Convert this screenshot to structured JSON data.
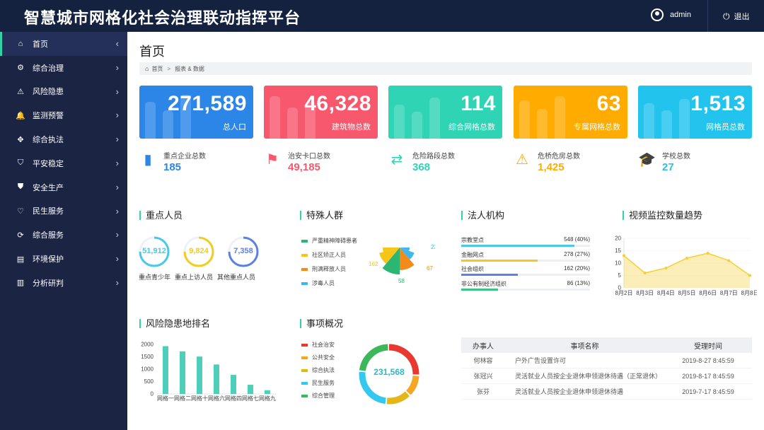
{
  "header": {
    "title": "智慧城市网格化社会治理联动指挥平台",
    "username": "admin",
    "logout_label": "退出"
  },
  "sidebar": {
    "items": [
      {
        "label": "首页",
        "icon": "home-icon",
        "glyph": "⌂"
      },
      {
        "label": "综合治理",
        "icon": "gear-icon",
        "glyph": "⚙"
      },
      {
        "label": "风险隐患",
        "icon": "warning-icon",
        "glyph": "⚠"
      },
      {
        "label": "监测预警",
        "icon": "bell-icon",
        "glyph": "🔔"
      },
      {
        "label": "综合执法",
        "icon": "move-icon",
        "glyph": "✥"
      },
      {
        "label": "平安稳定",
        "icon": "shield-check-icon",
        "glyph": "⛉"
      },
      {
        "label": "安全生产",
        "icon": "shield-icon",
        "glyph": "⛊"
      },
      {
        "label": "民生服务",
        "icon": "heart-icon",
        "glyph": "♡"
      },
      {
        "label": "综合服务",
        "icon": "sync-icon",
        "glyph": "⟳"
      },
      {
        "label": "环境保护",
        "icon": "building-icon",
        "glyph": "▤"
      },
      {
        "label": "分析研判",
        "icon": "chart-icon",
        "glyph": "▥"
      }
    ]
  },
  "page": {
    "title": "首页",
    "breadcrumb": [
      "首页",
      "报表 & 数据"
    ]
  },
  "stat_cards": [
    {
      "value": "271,589",
      "label": "总人口",
      "color": "#2b86e8"
    },
    {
      "value": "46,328",
      "label": "建筑物总数",
      "color": "#f7586d"
    },
    {
      "value": "114",
      "label": "综合网格总数",
      "color": "#2fd4b5"
    },
    {
      "value": "63",
      "label": "专属网格总数",
      "color": "#ffab00"
    },
    {
      "value": "1,513",
      "label": "网格员总数",
      "color": "#22c4ee"
    }
  ],
  "mini_stats": [
    {
      "label": "重点企业总数",
      "value": "185",
      "icon": "building-chart-icon",
      "color": "#2b86e8"
    },
    {
      "label": "治安卡口总数",
      "value": "49,185",
      "icon": "camera-icon",
      "color": "#f7586d"
    },
    {
      "label": "危险路段总数",
      "value": "368",
      "icon": "swap-arrows-icon",
      "color": "#2fd4b5"
    },
    {
      "label": "危桥危房总数",
      "value": "1,425",
      "icon": "warning-icon",
      "color": "#ffab00"
    },
    {
      "label": "学校总数",
      "value": "27",
      "icon": "graduation-cap-icon",
      "color": "#22c4ee"
    }
  ],
  "key_persons": {
    "title": "重点人员",
    "rings": [
      {
        "value": "51,912",
        "label": "重点青少年",
        "color": "#4ac8ea",
        "fraction": 0.75
      },
      {
        "value": "9,824",
        "label": "重点上访人员",
        "color": "#f2cc21",
        "fraction": 0.75
      },
      {
        "value": "7,358",
        "label": "其他重点人员",
        "color": "#5b82e0",
        "fraction": 0.75
      }
    ]
  },
  "special_groups": {
    "title": "特殊人群",
    "legend": [
      {
        "label": "严重精神障碍患者",
        "color": "#2bb673"
      },
      {
        "label": "社区矫正人员",
        "color": "#f5c518"
      },
      {
        "label": "刑满释放人员",
        "color": "#f38b1b"
      },
      {
        "label": "涉毒人员",
        "color": "#3fb7ea"
      }
    ],
    "values": [
      "23",
      "67",
      "58",
      "162"
    ]
  },
  "legal_entities": {
    "title": "法人机构",
    "rows": [
      {
        "name": "宗教堂点",
        "value": "548 (40%)",
        "fraction": 0.4,
        "color": "#4cc8e7"
      },
      {
        "name": "金融网点",
        "value": "278 (27%)",
        "fraction": 0.27,
        "color": "#f6c724"
      },
      {
        "name": "社会组织",
        "value": "162 (20%)",
        "fraction": 0.2,
        "color": "#5b82e0"
      },
      {
        "name": "非公有制经济组织",
        "value": "86 (13%)",
        "fraction": 0.13,
        "color": "#3bc287"
      }
    ]
  },
  "video_trend": {
    "title": "视频监控数量趋势",
    "chart_data": {
      "type": "area",
      "x": [
        "8月2日",
        "8月3日",
        "8月4日",
        "8月5日",
        "8月6日",
        "8月7日",
        "8月8日"
      ],
      "values": [
        13,
        6,
        8,
        12,
        14,
        11,
        5
      ],
      "ylim": [
        0,
        20
      ],
      "yticks": [
        "0",
        "5",
        "10",
        "15",
        "20"
      ],
      "color": "#f5cf36"
    }
  },
  "risk_ranking": {
    "title": "风险隐患地排名",
    "chart_data": {
      "type": "bar",
      "categories": [
        "网格一",
        "网格二",
        "网格十",
        "网格六",
        "网格四",
        "网格七",
        "网格九"
      ],
      "values": [
        1930,
        1720,
        1510,
        1190,
        770,
        370,
        150
      ],
      "ylim": [
        0,
        2000
      ],
      "yticks": [
        "0",
        "500",
        "1000",
        "1500",
        "2000"
      ],
      "color": "#2fc7ad"
    }
  },
  "matters": {
    "title": "事项概况",
    "total": "231,568",
    "legend": [
      {
        "label": "社会治安",
        "color": "#e8382f"
      },
      {
        "label": "公共安全",
        "color": "#f5a623"
      },
      {
        "label": "综合执法",
        "color": "#e4b61a"
      },
      {
        "label": "民生服务",
        "color": "#35c8ee"
      },
      {
        "label": "综合管理",
        "color": "#3bb85a"
      }
    ],
    "shares": [
      0.26,
      0.12,
      0.14,
      0.25,
      0.23
    ]
  },
  "table": {
    "headers": [
      "办事人",
      "事项名称",
      "受理时间"
    ],
    "rows": [
      [
        "何林容",
        "户外广告设置许可",
        "2019-8-27  8:45:59"
      ],
      [
        "张冠兴",
        "灵活就业人员按企业退休申领退休待遇（正常退休）",
        "2019-8-17  8:45:59"
      ],
      [
        "张芬",
        "灵活就业人员按企业退休申领退休待遇",
        "2019-7-17  8:45:59"
      ]
    ]
  }
}
